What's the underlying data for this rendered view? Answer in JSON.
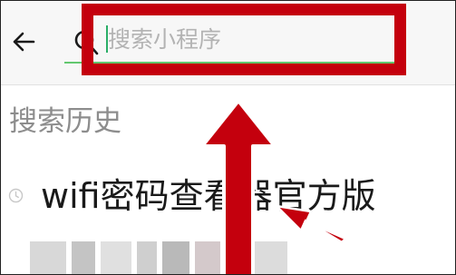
{
  "search": {
    "placeholder": "搜索小程序",
    "value": ""
  },
  "history": {
    "title": "搜索历史",
    "items": [
      {
        "label": "wifi密码查看器官方版"
      }
    ]
  },
  "colors": {
    "highlight_red": "#c4000d",
    "underline_green": "#62c76f",
    "caret_green": "#2aae67"
  },
  "icons": [
    "back-arrow-icon",
    "search-icon",
    "clock-icon"
  ]
}
